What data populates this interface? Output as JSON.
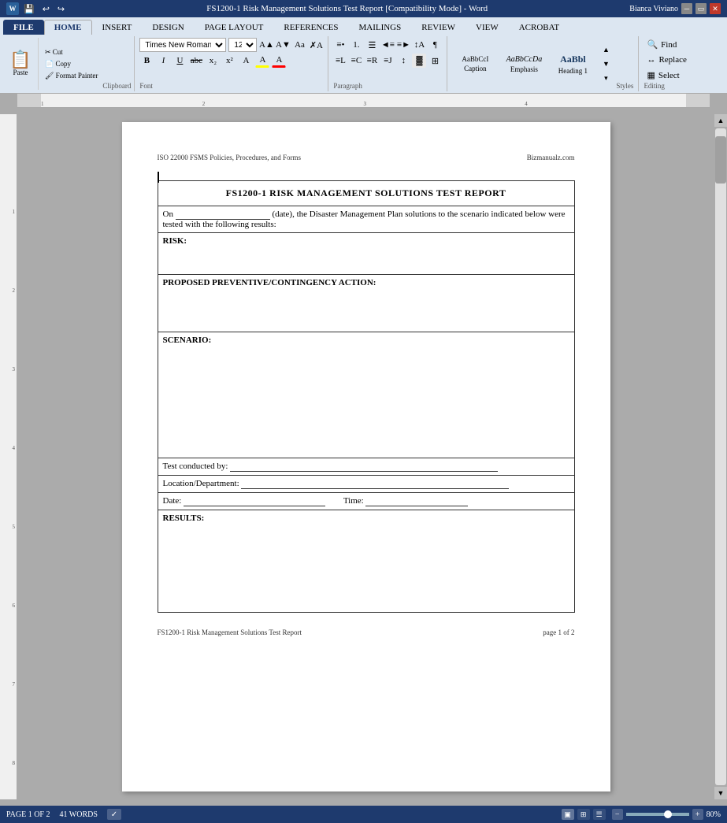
{
  "window": {
    "title": "FS1200-1 Risk Management Solutions Test Report [Compatibility Mode] - Word",
    "title_bar_buttons": [
      "minimize",
      "restore",
      "close"
    ]
  },
  "menu_bar": {
    "items": [
      "FILE",
      "HOME",
      "INSERT",
      "DESIGN",
      "PAGE LAYOUT",
      "REFERENCES",
      "MAILINGS",
      "REVIEW",
      "VIEW",
      "ACROBAT"
    ],
    "active": "HOME"
  },
  "ribbon": {
    "groups": {
      "clipboard": {
        "label": "Clipboard",
        "paste": "Paste"
      },
      "font": {
        "label": "Font",
        "font_name": "Times New Roman",
        "font_size": "12",
        "bold": "B",
        "italic": "I",
        "underline": "U"
      },
      "paragraph": {
        "label": "Paragraph"
      },
      "styles": {
        "label": "Styles",
        "items": [
          {
            "name": "Caption",
            "label": "Caption"
          },
          {
            "name": "Emphasis",
            "label": "Emphasis"
          },
          {
            "name": "Heading1",
            "label": "Heading 1"
          }
        ]
      },
      "editing": {
        "label": "Editing",
        "find": "Find",
        "replace": "Replace",
        "select": "Select"
      }
    }
  },
  "user": {
    "name": "Bianca Viviano"
  },
  "document": {
    "header_left": "ISO 22000 FSMS Policies, Procedures, and Forms",
    "header_right": "Bizmanualz.com",
    "title": "FS1200-1 RISK MANAGEMENT SOLUTIONS TEST REPORT",
    "intro": "On",
    "intro_date": "(date), the Disaster Management Plan solutions to the scenario indicated below were tested with the following results:",
    "sections": {
      "risk": {
        "label": "RISK:"
      },
      "proposed": {
        "label": "PROPOSED PREVENTIVE/CONTINGENCY ACTION:"
      },
      "scenario": {
        "label": "SCENARIO:"
      },
      "test_conducted": {
        "label": "Test conducted by:"
      },
      "location": {
        "label": "Location/Department:"
      },
      "date": {
        "label": "Date:"
      },
      "time": {
        "label": "Time:"
      },
      "results": {
        "label": "RESULTS:"
      }
    },
    "footer_left": "FS1200-1 Risk Management Solutions Test Report",
    "footer_right": "page 1 of 2"
  },
  "status_bar": {
    "page_info": "PAGE 1 OF 2",
    "word_count": "41 WORDS",
    "zoom": "80%",
    "zoom_label": "80%"
  }
}
